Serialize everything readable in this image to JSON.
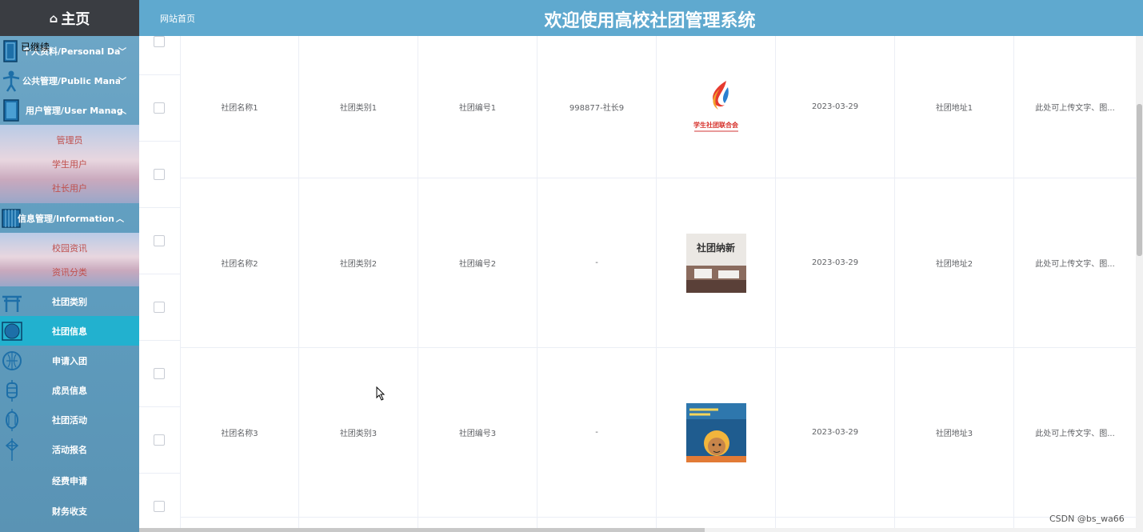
{
  "sidebar": {
    "home_label": "主页",
    "overlay_text": "已继续",
    "groups": [
      {
        "label": "个人资料/Personal Data",
        "chevron": "﹀",
        "icon": "book-icon"
      },
      {
        "label": "公共管理/Public Manage",
        "chevron": "﹀",
        "icon": "figure-icon"
      },
      {
        "label": "用户管理/User Manage",
        "chevron": "︿",
        "icon": "door-icon"
      },
      {
        "label": "信息管理/Information M...",
        "chevron": "︿",
        "icon": "lantern-box-icon"
      }
    ],
    "user_sub": [
      "管理员",
      "学生用户",
      "社长用户"
    ],
    "info_sub": [
      "校园资讯",
      "资讯分类"
    ],
    "items": [
      {
        "label": "社团类别",
        "icon": "torii-gate-icon"
      },
      {
        "label": "社团信息",
        "icon": "circle-frame-icon",
        "active": true
      },
      {
        "label": "申请入团",
        "icon": "lantern-icon"
      },
      {
        "label": "成员信息",
        "icon": "lantern-icon"
      },
      {
        "label": "社团活动",
        "icon": "lantern-icon"
      },
      {
        "label": "活动报名",
        "icon": "chinese-knot-icon"
      },
      {
        "label": "经费申请",
        "icon": ""
      },
      {
        "label": "财务收支",
        "icon": ""
      }
    ]
  },
  "header": {
    "home_link": "网站首页",
    "title": "欢迎使用高校社团管理系统"
  },
  "table": {
    "rows": [
      {
        "name": "社团名称1",
        "category": "社团类别1",
        "number": "社团编号1",
        "leader": "998877-社长9",
        "image": "student-union-logo",
        "date": "2023-03-29",
        "address": "社团地址1",
        "desc": "此处可上传文字、图..."
      },
      {
        "name": "社团名称2",
        "category": "社团类别2",
        "number": "社团编号2",
        "leader": "-",
        "image": "recruitment-photo",
        "date": "2023-03-29",
        "address": "社团地址2",
        "desc": "此处可上传文字、图..."
      },
      {
        "name": "社团名称3",
        "category": "社团类别3",
        "number": "社团编号3",
        "leader": "-",
        "image": "poster-illustration",
        "date": "2023-03-29",
        "address": "社团地址3",
        "desc": "此处可上传文字、图..."
      }
    ]
  },
  "logo_text": "学生社团联合会",
  "photo_text": "社团纳新",
  "watermark": "CSDN @bs_wa66",
  "colors": {
    "header": "#5fa9cf",
    "logo_bar": "#3a3d42",
    "active_item": "#22b1cf",
    "sub_text": "#c0504d"
  }
}
